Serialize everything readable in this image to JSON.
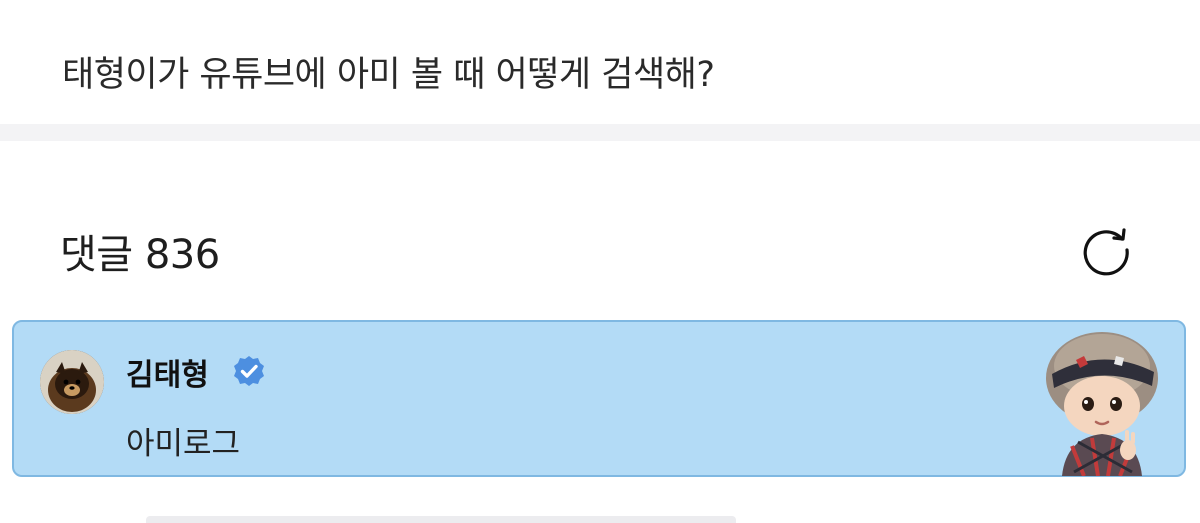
{
  "post": {
    "question": "태형이가 유튜브에 아미 볼 때 어떻게 검색해?"
  },
  "comments": {
    "header": "댓글 836",
    "refresh_icon": "refresh-icon",
    "pinned_comment": {
      "author": "김태형",
      "verified_icon": "verified-badge-icon",
      "text": "아미로그",
      "highlight_color": "#b3dbf6",
      "border_color": "#7fb8e2",
      "verified_color": "#4d8fe0"
    }
  }
}
